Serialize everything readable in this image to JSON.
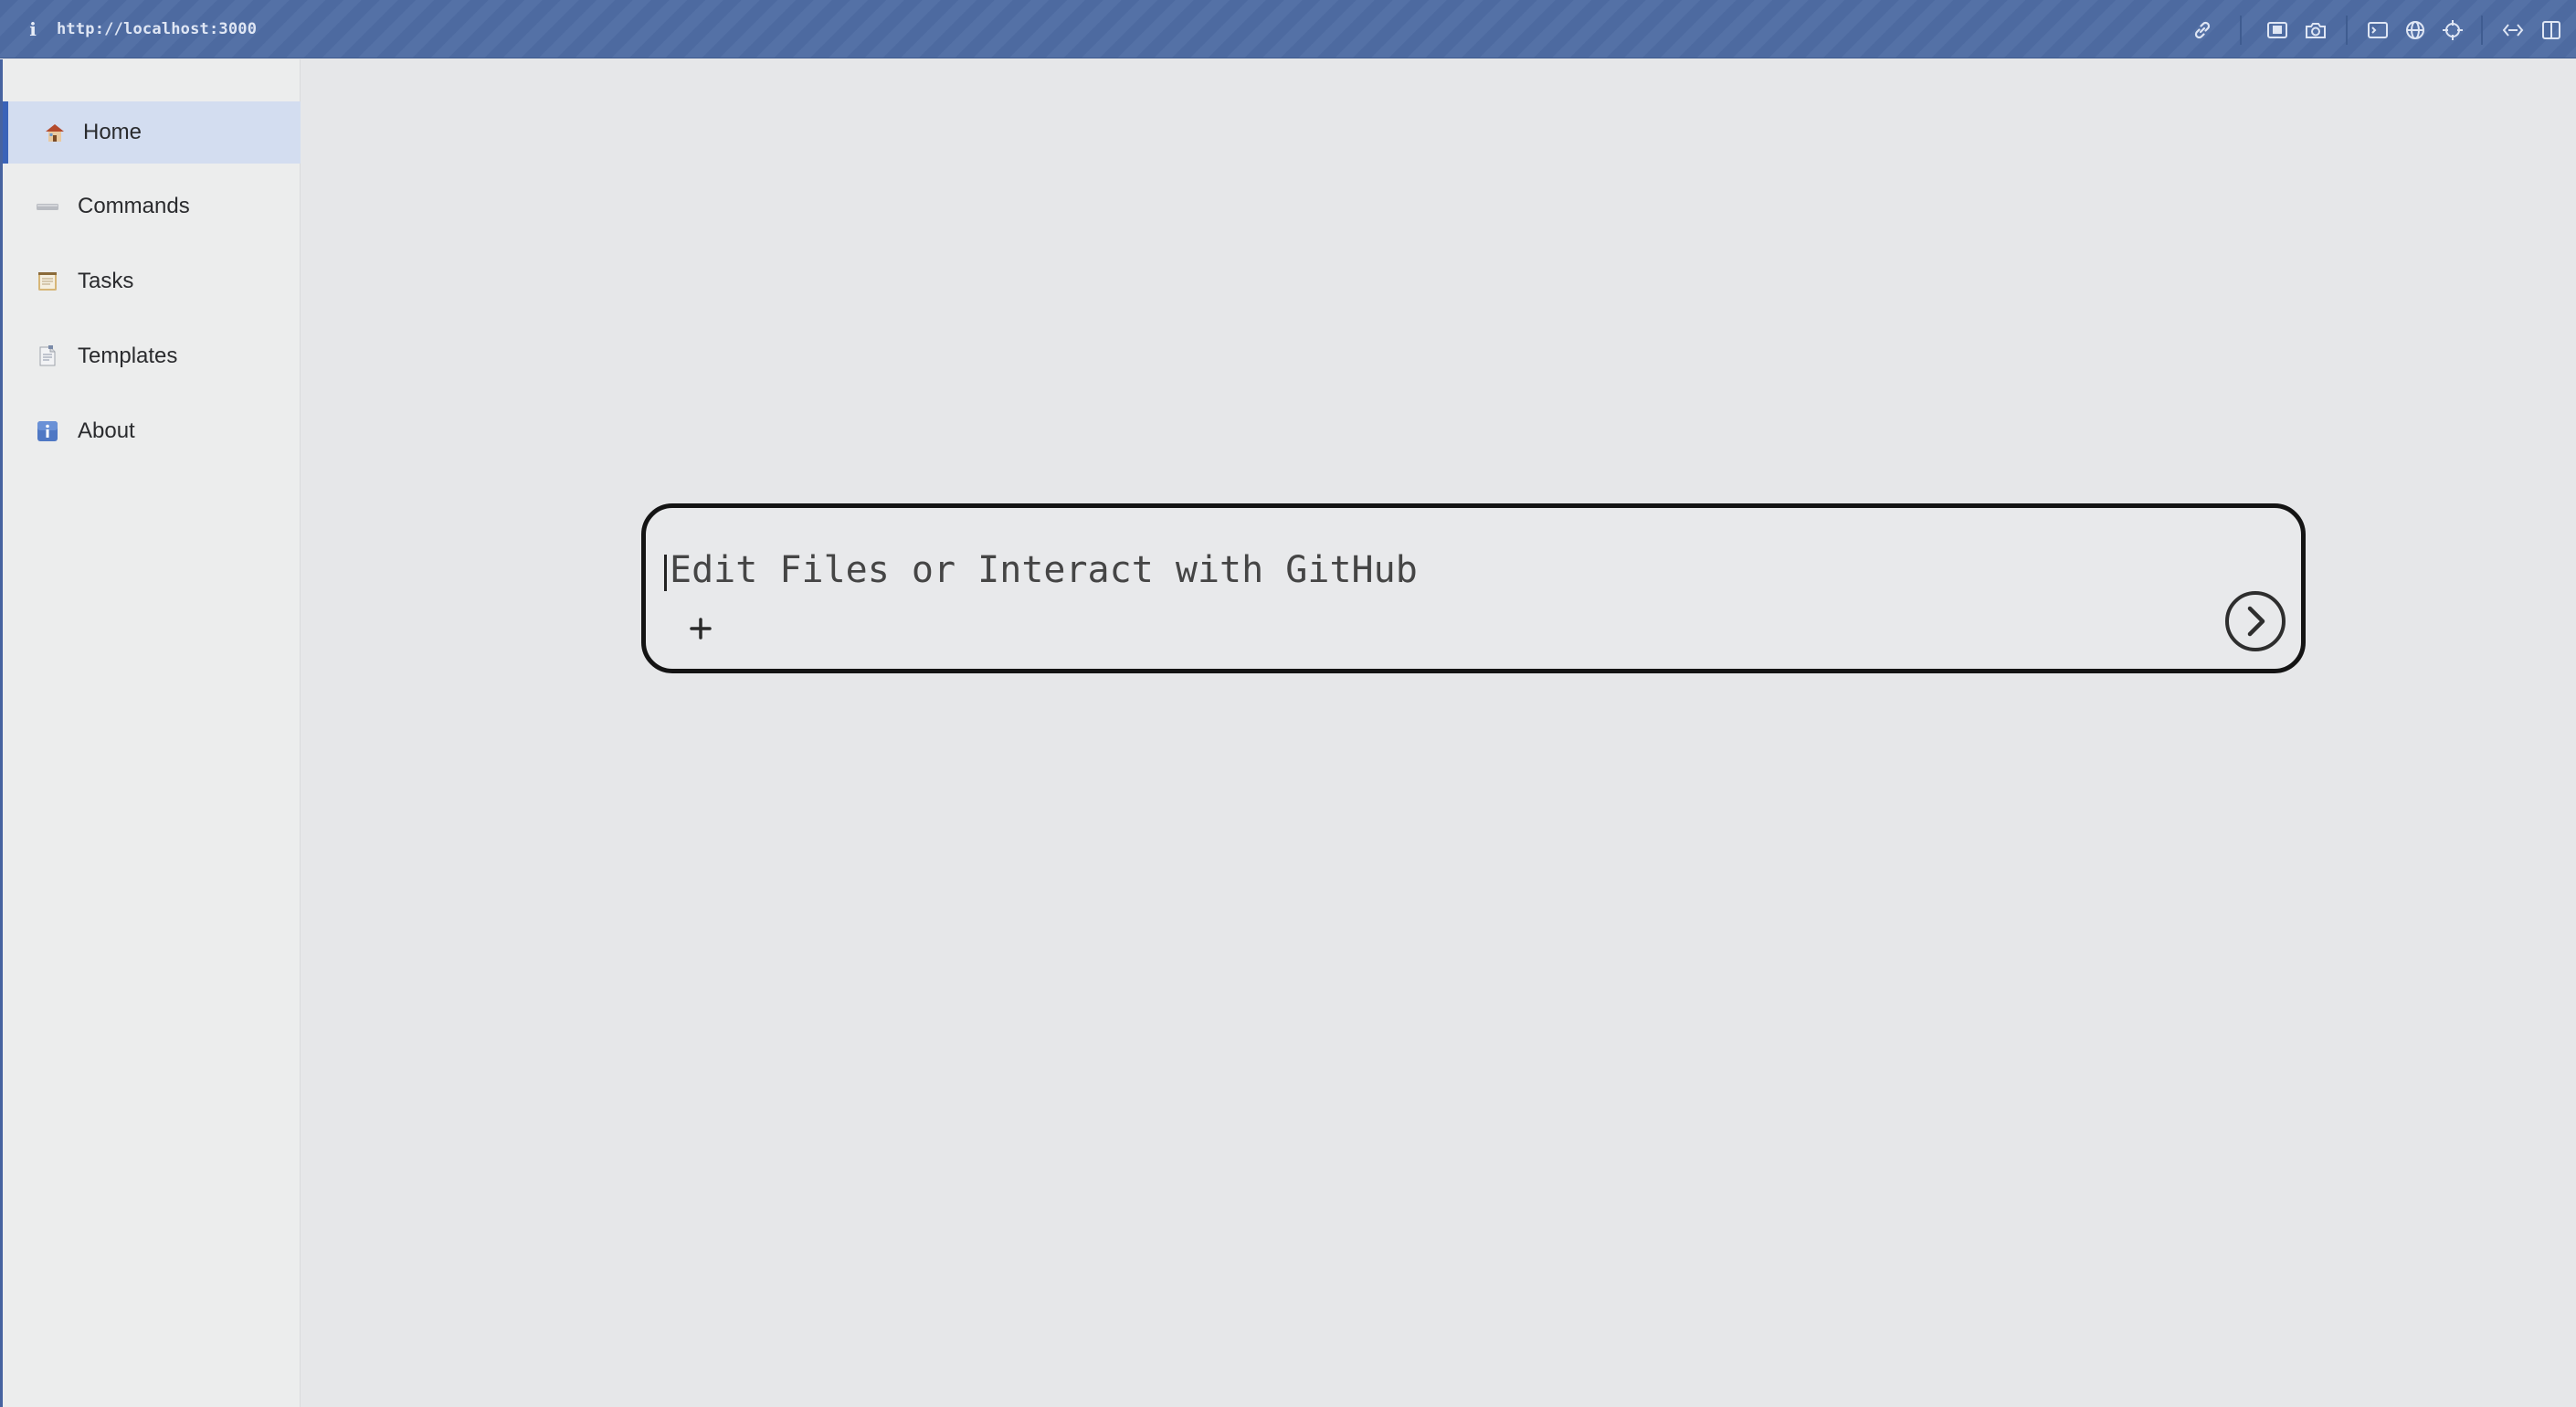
{
  "browser": {
    "url": "http://localhost:3000",
    "info_icon": "info-icon",
    "toolbar_icons": [
      "link-icon",
      "screenshot-region-icon",
      "camera-icon",
      "terminal-icon",
      "globe-icon",
      "crosshair-icon",
      "responsive-icon",
      "split-view-icon"
    ]
  },
  "sidebar": {
    "items": [
      {
        "label": "Home",
        "icon": "house-icon",
        "active": true
      },
      {
        "label": "Commands",
        "icon": "keyboard-icon",
        "active": false
      },
      {
        "label": "Tasks",
        "icon": "notepad-icon",
        "active": false
      },
      {
        "label": "Templates",
        "icon": "document-icon",
        "active": false
      },
      {
        "label": "About",
        "icon": "info-icon",
        "active": false
      }
    ]
  },
  "main": {
    "prompt": {
      "placeholder": "Edit Files or Interact with GitHub",
      "value": "",
      "add_symbol": "+"
    }
  },
  "colors": {
    "topbar": "#4d6aa0",
    "sidebar_active_bg": "#d3ddf0",
    "sidebar_active_accent": "#3a63b8",
    "page_bg": "#e6e7e9",
    "prompt_border": "#141414"
  }
}
